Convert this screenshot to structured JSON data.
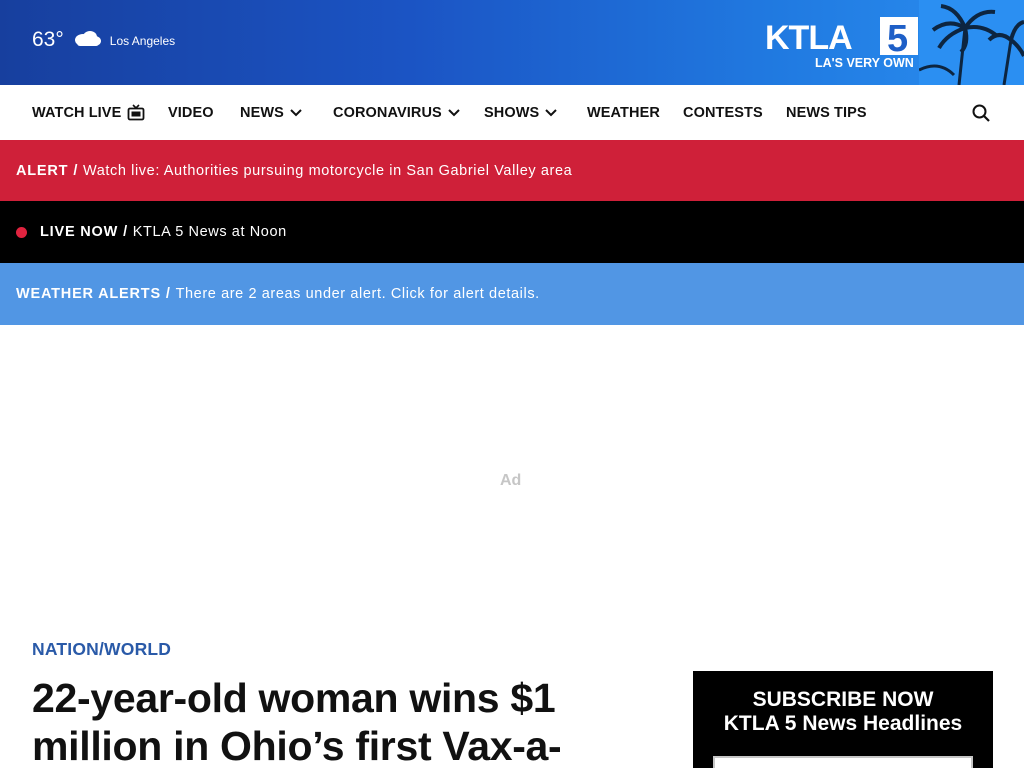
{
  "header": {
    "temperature": "63°",
    "city": "Los Angeles",
    "logo_text": "KTLA",
    "logo_number": "5",
    "tagline": "LA'S VERY OWN"
  },
  "nav": {
    "items": [
      {
        "label": "WATCH LIVE"
      },
      {
        "label": "VIDEO"
      },
      {
        "label": "NEWS"
      },
      {
        "label": "CORONAVIRUS"
      },
      {
        "label": "SHOWS"
      },
      {
        "label": "WEATHER"
      },
      {
        "label": "CONTESTS"
      },
      {
        "label": "NEWS TIPS"
      }
    ]
  },
  "alert": {
    "label": "ALERT",
    "separator": "/",
    "text": "Watch live: Authorities pursuing motorcycle in San Gabriel Valley area"
  },
  "live": {
    "label": "LIVE NOW",
    "separator": "/",
    "text": "KTLA 5 News at Noon"
  },
  "weather_alerts": {
    "label": "WEATHER ALERTS",
    "separator": "/",
    "text": "There are 2 areas under alert. Click for alert details."
  },
  "ad": {
    "label": "Ad"
  },
  "article": {
    "category": "NATION/WORLD",
    "headline": "22-year-old woman wins $1 million in Ohio’s first Vax-a-"
  },
  "subscribe": {
    "line1": "SUBSCRIBE NOW",
    "line2": "KTLA 5 News Headlines"
  },
  "colors": {
    "alert": "#cf2039",
    "live": "#000000",
    "weather_alert": "#5196e4",
    "category": "#2a5aa8"
  }
}
